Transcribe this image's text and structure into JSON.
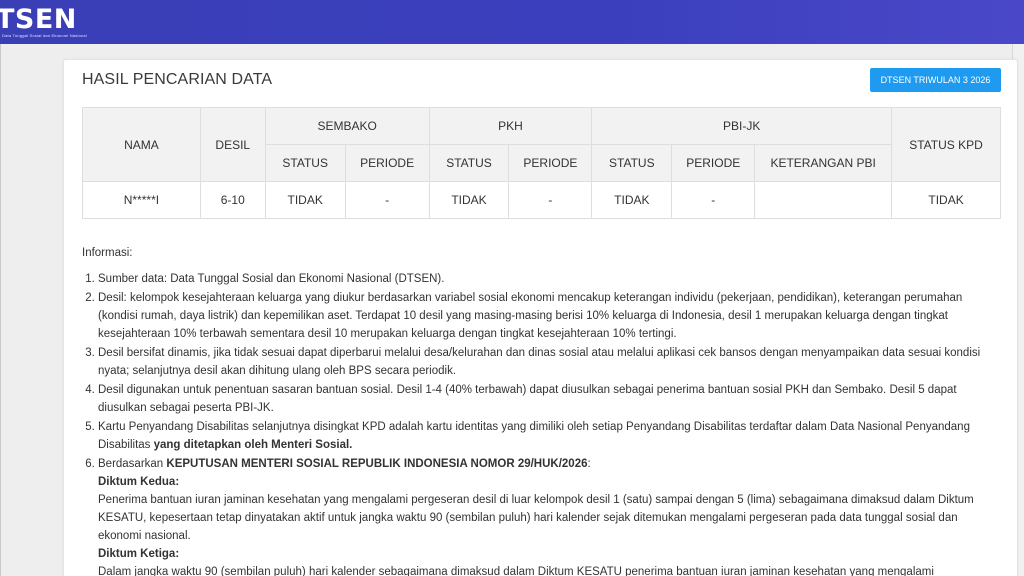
{
  "header": {
    "logo_text": "TSEN",
    "logo_sub": "Data Tunggal Sosial dan Ekonomi Nasional"
  },
  "card": {
    "title": "HASIL PENCARIAN DATA",
    "period_button": "DTSEN TRIWULAN 3 2026"
  },
  "table": {
    "headers": {
      "nama": "NAMA",
      "desil": "DESIL",
      "sembako": "SEMBAKO",
      "pkh": "PKH",
      "pbi": "PBI-JK",
      "status_kpd": "STATUS KPD",
      "status": "STATUS",
      "periode": "PERIODE",
      "keterangan_pbi": "KETERANGAN PBI"
    },
    "row": {
      "nama": "N*****I",
      "desil": "6-10",
      "sembako_status": "TIDAK",
      "sembako_periode": "-",
      "pkh_status": "TIDAK",
      "pkh_periode": "-",
      "pbi_status": "TIDAK",
      "pbi_periode": "-",
      "pbi_keterangan": "",
      "status_kpd": "TIDAK"
    }
  },
  "info": {
    "heading": "Informasi:",
    "item1": "Sumber data: Data Tunggal Sosial dan Ekonomi Nasional (DTSEN).",
    "item2": "Desil: kelompok kesejahteraan keluarga yang diukur berdasarkan variabel sosial ekonomi mencakup keterangan individu (pekerjaan, pendidikan), keterangan perumahan (kondisi rumah, daya listrik) dan kepemilikan aset. Terdapat 10 desil yang masing-masing berisi 10% keluarga di Indonesia, desil 1 merupakan keluarga dengan tingkat kesejahteraan 10% terbawah sementara desil 10 merupakan keluarga dengan tingkat kesejahteraan 10% tertingi.",
    "item3": "Desil bersifat dinamis, jika tidak sesuai dapat diperbarui melalui desa/kelurahan dan dinas sosial atau melalui aplikasi cek bansos dengan menyampaikan data sesuai kondisi nyata; selanjutnya desil akan dihitung ulang oleh BPS secara periodik.",
    "item4": "Desil digunakan untuk penentuan sasaran bantuan sosial. Desil 1-4 (40% terbawah) dapat diusulkan sebagai penerima bantuan sosial PKH dan Sembako. Desil 5 dapat diusulkan sebagai peserta PBI-JK.",
    "item5_a": "Kartu Penyandang Disabilitas selanjutnya disingkat KPD adalah kartu identitas yang dimiliki oleh setiap Penyandang Disabilitas terdaftar dalam Data Nasional Penyandang Disabilitas ",
    "item5_b": "yang ditetapkan oleh Menteri Sosial.",
    "item6_a": "Berdasarkan ",
    "item6_b": "KEPUTUSAN MENTERI SOSIAL REPUBLIK INDONESIA NOMOR 29/HUK/2026",
    "item6_c": ":",
    "diktum_kedua_label": "Diktum Kedua:",
    "diktum_kedua_text": "Penerima bantuan iuran jaminan kesehatan yang mengalami pergeseran desil di luar kelompok desil 1 (satu) sampai dengan 5 (lima) sebagaimana dimaksud dalam Diktum KESATU, kepesertaan tetap dinyatakan aktif untuk jangka waktu 90 (sembilan puluh) hari kalender sejak ditemukan mengalami pergeseran pada data tunggal sosial dan ekonomi nasional.",
    "diktum_ketiga_label": "Diktum Ketiga:",
    "diktum_ketiga_text": "Dalam jangka waktu 90 (sembilan puluh) hari kalender sebagaimana dimaksud dalam Diktum KESATU penerima bantuan iuran jaminan kesehatan yang mengalami"
  }
}
